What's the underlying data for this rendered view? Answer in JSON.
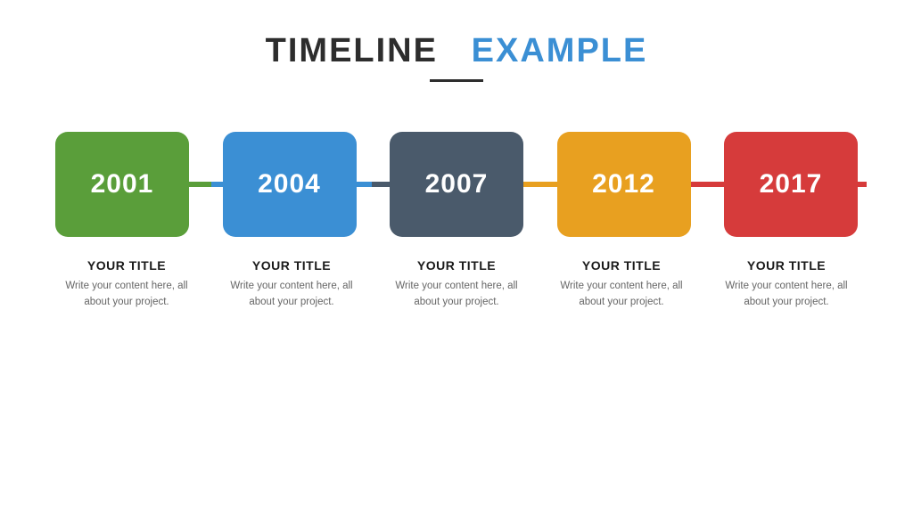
{
  "header": {
    "title_dark": "TIMELINE",
    "title_blue": "EXAMPLE"
  },
  "timeline": {
    "items": [
      {
        "year": "2001",
        "color_class": "box-green",
        "title": "YOUR TITLE",
        "description": "Write your content here, all about your project."
      },
      {
        "year": "2004",
        "color_class": "box-blue",
        "title": "YOUR TITLE",
        "description": "Write your content here, all about your project."
      },
      {
        "year": "2007",
        "color_class": "box-dark",
        "title": "YOUR TITLE",
        "description": "Write your content here, all about your project."
      },
      {
        "year": "2012",
        "color_class": "box-orange",
        "title": "YOUR TITLE",
        "description": "Write your content here, all about your project."
      },
      {
        "year": "2017",
        "color_class": "box-red",
        "title": "YOUR TITLE",
        "description": "Write your content here, all about your project."
      }
    ]
  }
}
